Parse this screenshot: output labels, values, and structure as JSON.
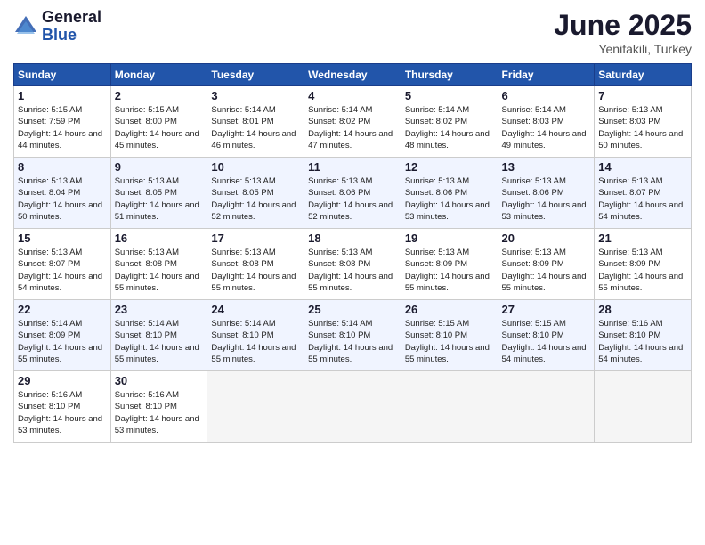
{
  "logo": {
    "general": "General",
    "blue": "Blue"
  },
  "title": "June 2025",
  "location": "Yenifakili, Turkey",
  "weekdays": [
    "Sunday",
    "Monday",
    "Tuesday",
    "Wednesday",
    "Thursday",
    "Friday",
    "Saturday"
  ],
  "weeks": [
    [
      {
        "day": "1",
        "sunrise": "5:15 AM",
        "sunset": "7:59 PM",
        "daylight": "14 hours and 44 minutes."
      },
      {
        "day": "2",
        "sunrise": "5:15 AM",
        "sunset": "8:00 PM",
        "daylight": "14 hours and 45 minutes."
      },
      {
        "day": "3",
        "sunrise": "5:14 AM",
        "sunset": "8:01 PM",
        "daylight": "14 hours and 46 minutes."
      },
      {
        "day": "4",
        "sunrise": "5:14 AM",
        "sunset": "8:02 PM",
        "daylight": "14 hours and 47 minutes."
      },
      {
        "day": "5",
        "sunrise": "5:14 AM",
        "sunset": "8:02 PM",
        "daylight": "14 hours and 48 minutes."
      },
      {
        "day": "6",
        "sunrise": "5:14 AM",
        "sunset": "8:03 PM",
        "daylight": "14 hours and 49 minutes."
      },
      {
        "day": "7",
        "sunrise": "5:13 AM",
        "sunset": "8:03 PM",
        "daylight": "14 hours and 50 minutes."
      }
    ],
    [
      {
        "day": "8",
        "sunrise": "5:13 AM",
        "sunset": "8:04 PM",
        "daylight": "14 hours and 50 minutes."
      },
      {
        "day": "9",
        "sunrise": "5:13 AM",
        "sunset": "8:05 PM",
        "daylight": "14 hours and 51 minutes."
      },
      {
        "day": "10",
        "sunrise": "5:13 AM",
        "sunset": "8:05 PM",
        "daylight": "14 hours and 52 minutes."
      },
      {
        "day": "11",
        "sunrise": "5:13 AM",
        "sunset": "8:06 PM",
        "daylight": "14 hours and 52 minutes."
      },
      {
        "day": "12",
        "sunrise": "5:13 AM",
        "sunset": "8:06 PM",
        "daylight": "14 hours and 53 minutes."
      },
      {
        "day": "13",
        "sunrise": "5:13 AM",
        "sunset": "8:06 PM",
        "daylight": "14 hours and 53 minutes."
      },
      {
        "day": "14",
        "sunrise": "5:13 AM",
        "sunset": "8:07 PM",
        "daylight": "14 hours and 54 minutes."
      }
    ],
    [
      {
        "day": "15",
        "sunrise": "5:13 AM",
        "sunset": "8:07 PM",
        "daylight": "14 hours and 54 minutes."
      },
      {
        "day": "16",
        "sunrise": "5:13 AM",
        "sunset": "8:08 PM",
        "daylight": "14 hours and 55 minutes."
      },
      {
        "day": "17",
        "sunrise": "5:13 AM",
        "sunset": "8:08 PM",
        "daylight": "14 hours and 55 minutes."
      },
      {
        "day": "18",
        "sunrise": "5:13 AM",
        "sunset": "8:08 PM",
        "daylight": "14 hours and 55 minutes."
      },
      {
        "day": "19",
        "sunrise": "5:13 AM",
        "sunset": "8:09 PM",
        "daylight": "14 hours and 55 minutes."
      },
      {
        "day": "20",
        "sunrise": "5:13 AM",
        "sunset": "8:09 PM",
        "daylight": "14 hours and 55 minutes."
      },
      {
        "day": "21",
        "sunrise": "5:13 AM",
        "sunset": "8:09 PM",
        "daylight": "14 hours and 55 minutes."
      }
    ],
    [
      {
        "day": "22",
        "sunrise": "5:14 AM",
        "sunset": "8:09 PM",
        "daylight": "14 hours and 55 minutes."
      },
      {
        "day": "23",
        "sunrise": "5:14 AM",
        "sunset": "8:10 PM",
        "daylight": "14 hours and 55 minutes."
      },
      {
        "day": "24",
        "sunrise": "5:14 AM",
        "sunset": "8:10 PM",
        "daylight": "14 hours and 55 minutes."
      },
      {
        "day": "25",
        "sunrise": "5:14 AM",
        "sunset": "8:10 PM",
        "daylight": "14 hours and 55 minutes."
      },
      {
        "day": "26",
        "sunrise": "5:15 AM",
        "sunset": "8:10 PM",
        "daylight": "14 hours and 55 minutes."
      },
      {
        "day": "27",
        "sunrise": "5:15 AM",
        "sunset": "8:10 PM",
        "daylight": "14 hours and 54 minutes."
      },
      {
        "day": "28",
        "sunrise": "5:16 AM",
        "sunset": "8:10 PM",
        "daylight": "14 hours and 54 minutes."
      }
    ],
    [
      {
        "day": "29",
        "sunrise": "5:16 AM",
        "sunset": "8:10 PM",
        "daylight": "14 hours and 53 minutes."
      },
      {
        "day": "30",
        "sunrise": "5:16 AM",
        "sunset": "8:10 PM",
        "daylight": "14 hours and 53 minutes."
      },
      null,
      null,
      null,
      null,
      null
    ]
  ]
}
